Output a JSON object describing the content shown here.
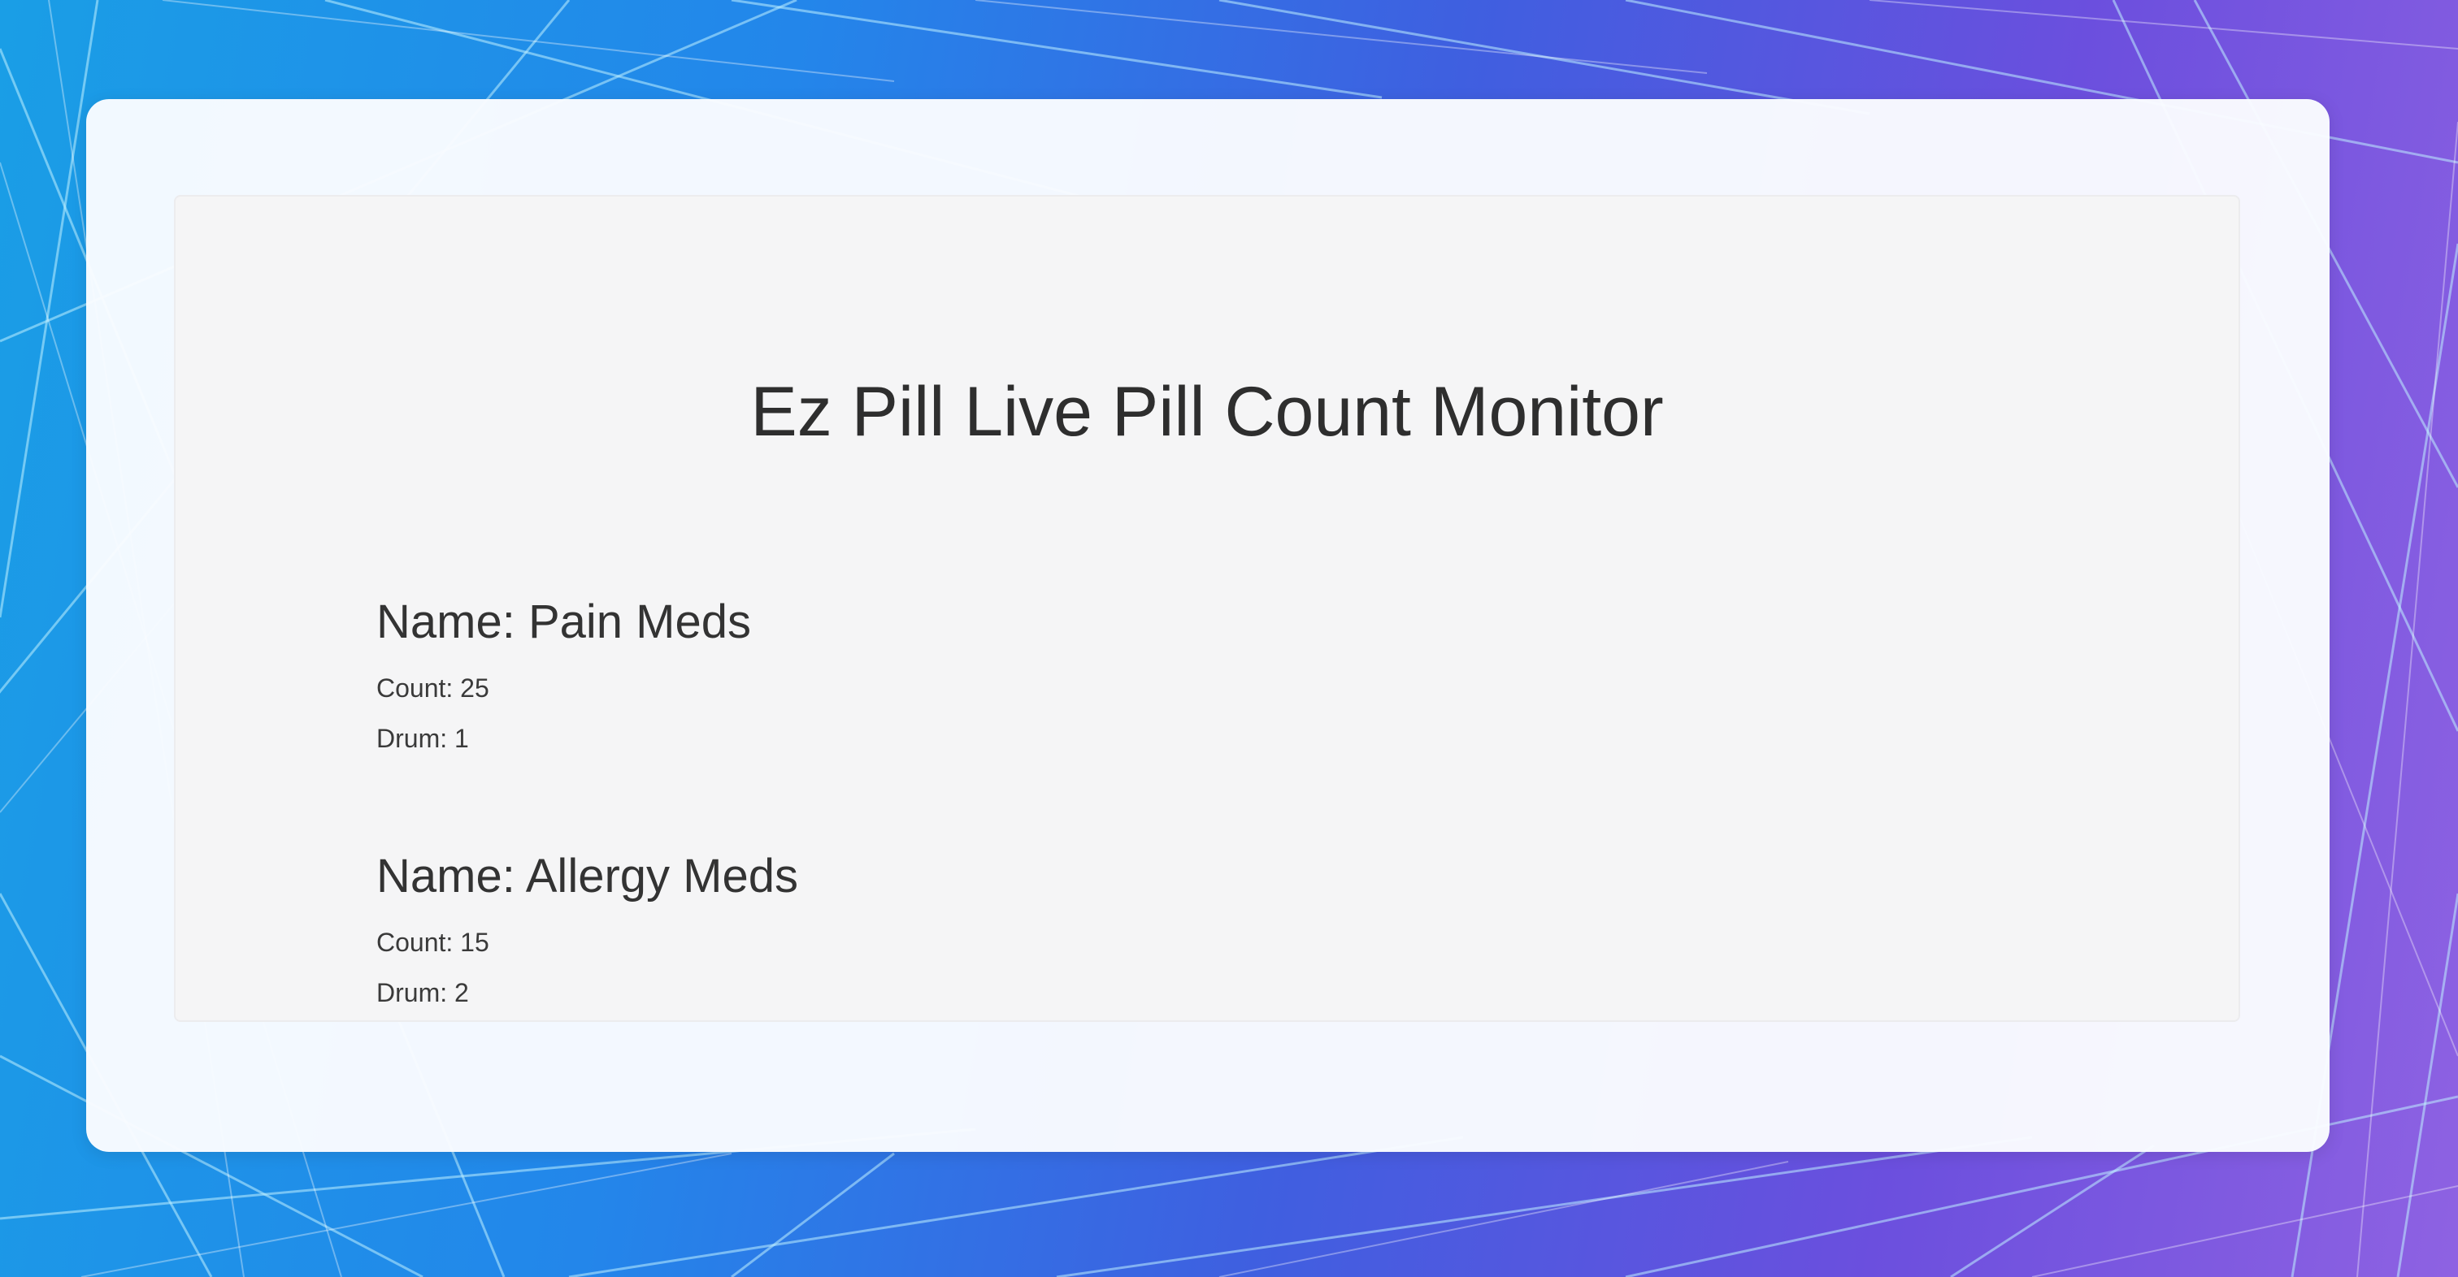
{
  "page": {
    "title": "Ez Pill Live Pill Count Monitor"
  },
  "medications": [
    {
      "name": "Name: Pain Meds",
      "count": "Count: 25",
      "drum": "Drum: 1"
    },
    {
      "name": "Name: Allergy Meds",
      "count": "Count: 15",
      "drum": "Drum: 2"
    }
  ],
  "colors": {
    "background_start": "#1a9ee6",
    "background_end": "#8e62e2",
    "card": "#fafcff",
    "panel": "#f5f5f6",
    "text": "#2e2e2e"
  }
}
